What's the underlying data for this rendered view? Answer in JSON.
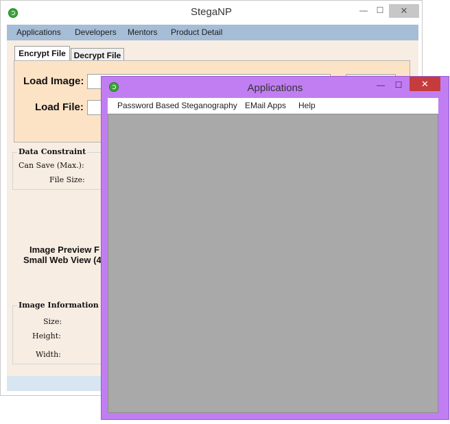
{
  "main_window": {
    "title": "StegaNP",
    "controls": {
      "minimize": "—",
      "maximize": "☐",
      "close": "✕"
    },
    "menu": [
      "Applications",
      "Developers",
      "Mentors",
      "Product Detail"
    ],
    "tabs": [
      {
        "label": "Encrypt File",
        "active": true
      },
      {
        "label": "Decrypt File",
        "active": false
      }
    ],
    "encrypt": {
      "load_image_label": "Load Image:",
      "load_file_label": "Load File:"
    },
    "data_constraint": {
      "title": "Data Constraint",
      "can_save_label": "Can Save (Max.):",
      "file_size_label": "File Size:"
    },
    "preview": {
      "line1": "Image Preview F",
      "line2": "Small Web View (4"
    },
    "image_information": {
      "title": "Image Information",
      "size_label": "Size:",
      "height_label": "Height:",
      "width_label": "Width:"
    }
  },
  "apps_window": {
    "title": "Applications",
    "controls": {
      "minimize": "—",
      "maximize": "☐",
      "close": "✕"
    },
    "menu": [
      "Password Based Steganography",
      "EMail Apps",
      "Help"
    ]
  },
  "colors": {
    "main_menubar": "#a5bdd6",
    "main_body": "#f8ede3",
    "tab_panel": "#fde3c6",
    "apps_frame": "#c17ef2",
    "apps_client": "#a9a9a9",
    "close_active": "#c63b3b"
  },
  "icons": {
    "app_icon": "green-circle-refresh-icon"
  }
}
